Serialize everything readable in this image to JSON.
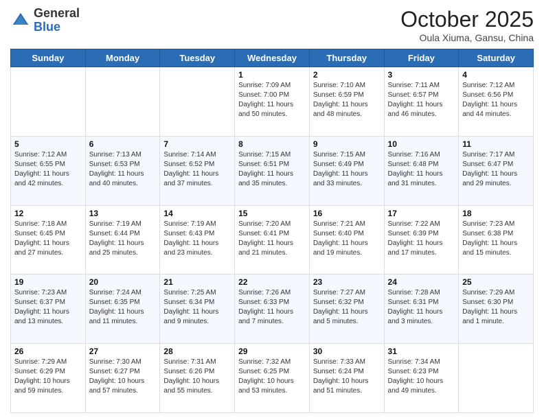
{
  "header": {
    "logo_line1": "General",
    "logo_line2": "Blue",
    "month_title": "October 2025",
    "location": "Oula Xiuma, Gansu, China"
  },
  "weekdays": [
    "Sunday",
    "Monday",
    "Tuesday",
    "Wednesday",
    "Thursday",
    "Friday",
    "Saturday"
  ],
  "weeks": [
    [
      {
        "day": "",
        "info": ""
      },
      {
        "day": "",
        "info": ""
      },
      {
        "day": "",
        "info": ""
      },
      {
        "day": "1",
        "info": "Sunrise: 7:09 AM\nSunset: 7:00 PM\nDaylight: 11 hours and 50 minutes."
      },
      {
        "day": "2",
        "info": "Sunrise: 7:10 AM\nSunset: 6:59 PM\nDaylight: 11 hours and 48 minutes."
      },
      {
        "day": "3",
        "info": "Sunrise: 7:11 AM\nSunset: 6:57 PM\nDaylight: 11 hours and 46 minutes."
      },
      {
        "day": "4",
        "info": "Sunrise: 7:12 AM\nSunset: 6:56 PM\nDaylight: 11 hours and 44 minutes."
      }
    ],
    [
      {
        "day": "5",
        "info": "Sunrise: 7:12 AM\nSunset: 6:55 PM\nDaylight: 11 hours and 42 minutes."
      },
      {
        "day": "6",
        "info": "Sunrise: 7:13 AM\nSunset: 6:53 PM\nDaylight: 11 hours and 40 minutes."
      },
      {
        "day": "7",
        "info": "Sunrise: 7:14 AM\nSunset: 6:52 PM\nDaylight: 11 hours and 37 minutes."
      },
      {
        "day": "8",
        "info": "Sunrise: 7:15 AM\nSunset: 6:51 PM\nDaylight: 11 hours and 35 minutes."
      },
      {
        "day": "9",
        "info": "Sunrise: 7:15 AM\nSunset: 6:49 PM\nDaylight: 11 hours and 33 minutes."
      },
      {
        "day": "10",
        "info": "Sunrise: 7:16 AM\nSunset: 6:48 PM\nDaylight: 11 hours and 31 minutes."
      },
      {
        "day": "11",
        "info": "Sunrise: 7:17 AM\nSunset: 6:47 PM\nDaylight: 11 hours and 29 minutes."
      }
    ],
    [
      {
        "day": "12",
        "info": "Sunrise: 7:18 AM\nSunset: 6:45 PM\nDaylight: 11 hours and 27 minutes."
      },
      {
        "day": "13",
        "info": "Sunrise: 7:19 AM\nSunset: 6:44 PM\nDaylight: 11 hours and 25 minutes."
      },
      {
        "day": "14",
        "info": "Sunrise: 7:19 AM\nSunset: 6:43 PM\nDaylight: 11 hours and 23 minutes."
      },
      {
        "day": "15",
        "info": "Sunrise: 7:20 AM\nSunset: 6:41 PM\nDaylight: 11 hours and 21 minutes."
      },
      {
        "day": "16",
        "info": "Sunrise: 7:21 AM\nSunset: 6:40 PM\nDaylight: 11 hours and 19 minutes."
      },
      {
        "day": "17",
        "info": "Sunrise: 7:22 AM\nSunset: 6:39 PM\nDaylight: 11 hours and 17 minutes."
      },
      {
        "day": "18",
        "info": "Sunrise: 7:23 AM\nSunset: 6:38 PM\nDaylight: 11 hours and 15 minutes."
      }
    ],
    [
      {
        "day": "19",
        "info": "Sunrise: 7:23 AM\nSunset: 6:37 PM\nDaylight: 11 hours and 13 minutes."
      },
      {
        "day": "20",
        "info": "Sunrise: 7:24 AM\nSunset: 6:35 PM\nDaylight: 11 hours and 11 minutes."
      },
      {
        "day": "21",
        "info": "Sunrise: 7:25 AM\nSunset: 6:34 PM\nDaylight: 11 hours and 9 minutes."
      },
      {
        "day": "22",
        "info": "Sunrise: 7:26 AM\nSunset: 6:33 PM\nDaylight: 11 hours and 7 minutes."
      },
      {
        "day": "23",
        "info": "Sunrise: 7:27 AM\nSunset: 6:32 PM\nDaylight: 11 hours and 5 minutes."
      },
      {
        "day": "24",
        "info": "Sunrise: 7:28 AM\nSunset: 6:31 PM\nDaylight: 11 hours and 3 minutes."
      },
      {
        "day": "25",
        "info": "Sunrise: 7:29 AM\nSunset: 6:30 PM\nDaylight: 11 hours and 1 minute."
      }
    ],
    [
      {
        "day": "26",
        "info": "Sunrise: 7:29 AM\nSunset: 6:29 PM\nDaylight: 10 hours and 59 minutes."
      },
      {
        "day": "27",
        "info": "Sunrise: 7:30 AM\nSunset: 6:27 PM\nDaylight: 10 hours and 57 minutes."
      },
      {
        "day": "28",
        "info": "Sunrise: 7:31 AM\nSunset: 6:26 PM\nDaylight: 10 hours and 55 minutes."
      },
      {
        "day": "29",
        "info": "Sunrise: 7:32 AM\nSunset: 6:25 PM\nDaylight: 10 hours and 53 minutes."
      },
      {
        "day": "30",
        "info": "Sunrise: 7:33 AM\nSunset: 6:24 PM\nDaylight: 10 hours and 51 minutes."
      },
      {
        "day": "31",
        "info": "Sunrise: 7:34 AM\nSunset: 6:23 PM\nDaylight: 10 hours and 49 minutes."
      },
      {
        "day": "",
        "info": ""
      }
    ]
  ]
}
